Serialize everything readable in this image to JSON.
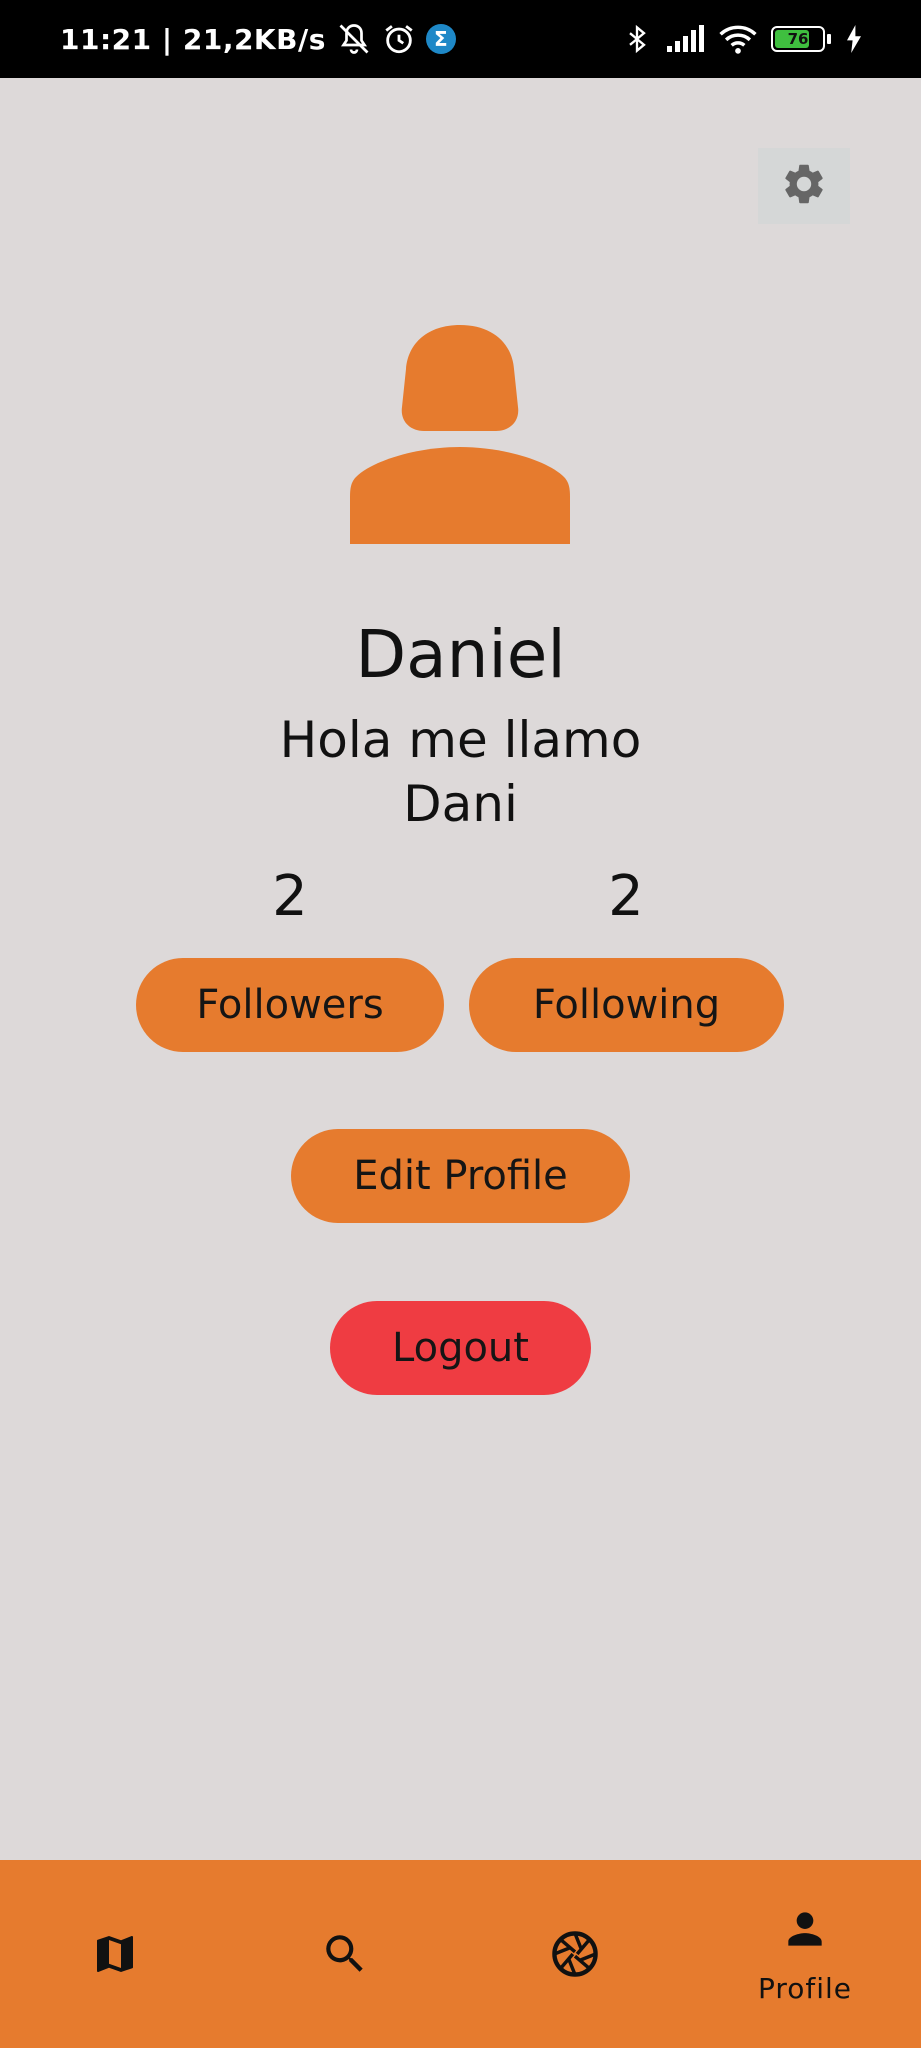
{
  "status_bar": {
    "time_speed": "11:21 | 21,2KB/s",
    "badge_letter": "Σ",
    "battery_level": "76",
    "battery_fraction": 0.76
  },
  "profile": {
    "name": "Daniel",
    "bio": "Hola me llamo Dani",
    "followers_count": "2",
    "following_count": "2"
  },
  "buttons": {
    "followers": "Followers",
    "following": "Following",
    "edit_profile": "Edit Profile",
    "logout": "Logout"
  },
  "bottom_nav": {
    "items": [
      {
        "icon": "map-icon",
        "label": ""
      },
      {
        "icon": "search-icon",
        "label": ""
      },
      {
        "icon": "camera-shutter-icon",
        "label": ""
      },
      {
        "icon": "person-icon",
        "label": "Profile"
      }
    ]
  },
  "colors": {
    "accent": "#e67b2e",
    "danger": "#ef3c42",
    "background": "#ddd9d9",
    "settings_icon": "#666666"
  }
}
